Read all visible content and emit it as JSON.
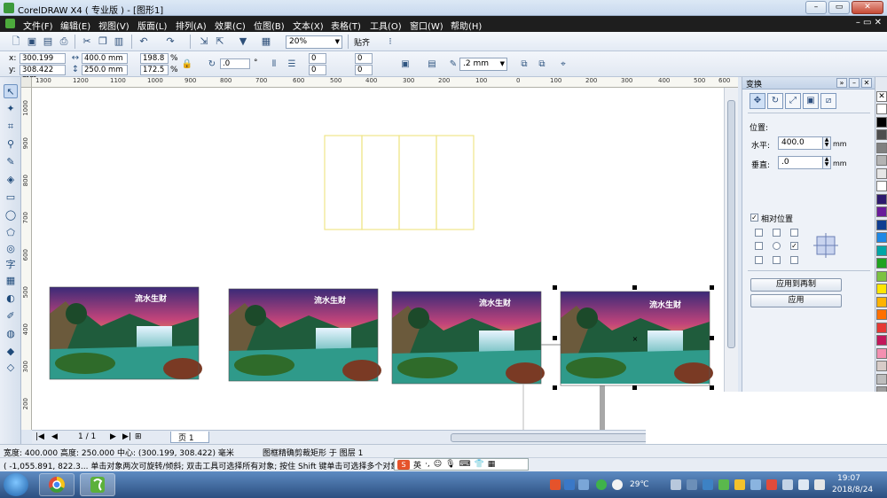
{
  "titlebar": {
    "title": "CorelDRAW X4 ( 专业版 ) - [图形1]",
    "min": "–",
    "max": "▭",
    "close": "✕"
  },
  "menu": {
    "items": [
      "文件(F)",
      "编辑(E)",
      "视图(V)",
      "版面(L)",
      "排列(A)",
      "效果(C)",
      "位图(B)",
      "文本(X)",
      "表格(T)",
      "工具(O)",
      "窗口(W)",
      "帮助(H)"
    ],
    "window_controls": "– ▭ ✕"
  },
  "toolbar": {
    "zoom": "20%",
    "snap": "贴齐"
  },
  "propbar": {
    "x": "300.199 mm",
    "y": "308.422 mm",
    "width": "400.0 mm",
    "height": "250.0 mm",
    "scale_x": "198.8",
    "scale_y": "172.5",
    "percent": "%",
    "rotation": ".0",
    "degree": "°",
    "skew1": "0",
    "skew2": "0",
    "corner1": "0",
    "corner2": "0",
    "outline": ".2 mm"
  },
  "rulers": {
    "h": [
      "1300",
      "1200",
      "1100",
      "1000",
      "900",
      "800",
      "700",
      "600",
      "500",
      "400",
      "300",
      "200",
      "100",
      "0",
      "100",
      "200",
      "300",
      "400",
      "500",
      "600"
    ],
    "v": [
      "1000",
      "900",
      "800",
      "700",
      "600",
      "500",
      "400",
      "300",
      "200"
    ],
    "unit": "毫米"
  },
  "canvas": {
    "image_caption": "流水生财"
  },
  "pagenav": {
    "count": "1 / 1",
    "page_tab": "页 1"
  },
  "docker": {
    "title": "变换",
    "section_position": "位置:",
    "label_h": "水平:",
    "value_h": "400.0",
    "unit_h": "mm",
    "label_v": "垂直:",
    "value_v": ".0",
    "unit_v": "mm",
    "relative_label": "相对位置",
    "apply_copy": "应用到再制",
    "apply": "应用"
  },
  "colors": {
    "palette": [
      "#ffffff",
      "#000000",
      "#4d4d4d",
      "#808080",
      "#b3b3b3",
      "#e6e6e6",
      "#ffffff",
      "#2e1a6e",
      "#6a1b9a",
      "#0f3d91",
      "#1e88e5",
      "#00a6a6",
      "#1fa31f",
      "#7cc242",
      "#ffe600",
      "#ffb300",
      "#ff6f00",
      "#e53935",
      "#c2185b",
      "#f48fb1",
      "#d7ccc8",
      "#bdbdbd",
      "#9e9e9e",
      "#ffffff"
    ]
  },
  "status": {
    "line1_left": "宽度: 400.000 高度: 250.000 中心: (300.199, 308.422) 毫米",
    "line1_center": "图框精确剪裁矩形 于 图层 1",
    "line2": "( -1,055.891, 822.3... 单击对象两次可旋转/倾斜; 双击工具可选择所有对象; 按住 Shift 键单击可选择多个对象; 按..."
  },
  "ime": {
    "lang": "英"
  },
  "taskbar": {
    "temp": "29℃",
    "time": "19:07",
    "date": "2018/8/24"
  }
}
